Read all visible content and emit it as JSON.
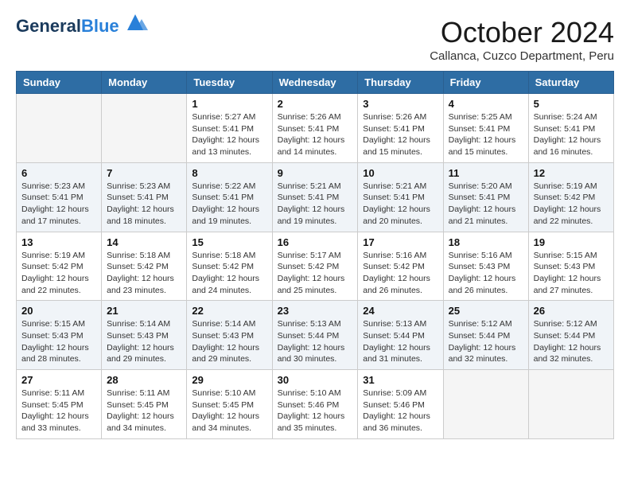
{
  "header": {
    "logo_line1": "General",
    "logo_line2": "Blue",
    "month": "October 2024",
    "location": "Callanca, Cuzco Department, Peru"
  },
  "days_of_week": [
    "Sunday",
    "Monday",
    "Tuesday",
    "Wednesday",
    "Thursday",
    "Friday",
    "Saturday"
  ],
  "weeks": [
    [
      {
        "day": "",
        "sunrise": "",
        "sunset": "",
        "daylight": ""
      },
      {
        "day": "",
        "sunrise": "",
        "sunset": "",
        "daylight": ""
      },
      {
        "day": "1",
        "sunrise": "Sunrise: 5:27 AM",
        "sunset": "Sunset: 5:41 PM",
        "daylight": "Daylight: 12 hours and 13 minutes."
      },
      {
        "day": "2",
        "sunrise": "Sunrise: 5:26 AM",
        "sunset": "Sunset: 5:41 PM",
        "daylight": "Daylight: 12 hours and 14 minutes."
      },
      {
        "day": "3",
        "sunrise": "Sunrise: 5:26 AM",
        "sunset": "Sunset: 5:41 PM",
        "daylight": "Daylight: 12 hours and 15 minutes."
      },
      {
        "day": "4",
        "sunrise": "Sunrise: 5:25 AM",
        "sunset": "Sunset: 5:41 PM",
        "daylight": "Daylight: 12 hours and 15 minutes."
      },
      {
        "day": "5",
        "sunrise": "Sunrise: 5:24 AM",
        "sunset": "Sunset: 5:41 PM",
        "daylight": "Daylight: 12 hours and 16 minutes."
      }
    ],
    [
      {
        "day": "6",
        "sunrise": "Sunrise: 5:23 AM",
        "sunset": "Sunset: 5:41 PM",
        "daylight": "Daylight: 12 hours and 17 minutes."
      },
      {
        "day": "7",
        "sunrise": "Sunrise: 5:23 AM",
        "sunset": "Sunset: 5:41 PM",
        "daylight": "Daylight: 12 hours and 18 minutes."
      },
      {
        "day": "8",
        "sunrise": "Sunrise: 5:22 AM",
        "sunset": "Sunset: 5:41 PM",
        "daylight": "Daylight: 12 hours and 19 minutes."
      },
      {
        "day": "9",
        "sunrise": "Sunrise: 5:21 AM",
        "sunset": "Sunset: 5:41 PM",
        "daylight": "Daylight: 12 hours and 19 minutes."
      },
      {
        "day": "10",
        "sunrise": "Sunrise: 5:21 AM",
        "sunset": "Sunset: 5:41 PM",
        "daylight": "Daylight: 12 hours and 20 minutes."
      },
      {
        "day": "11",
        "sunrise": "Sunrise: 5:20 AM",
        "sunset": "Sunset: 5:41 PM",
        "daylight": "Daylight: 12 hours and 21 minutes."
      },
      {
        "day": "12",
        "sunrise": "Sunrise: 5:19 AM",
        "sunset": "Sunset: 5:42 PM",
        "daylight": "Daylight: 12 hours and 22 minutes."
      }
    ],
    [
      {
        "day": "13",
        "sunrise": "Sunrise: 5:19 AM",
        "sunset": "Sunset: 5:42 PM",
        "daylight": "Daylight: 12 hours and 22 minutes."
      },
      {
        "day": "14",
        "sunrise": "Sunrise: 5:18 AM",
        "sunset": "Sunset: 5:42 PM",
        "daylight": "Daylight: 12 hours and 23 minutes."
      },
      {
        "day": "15",
        "sunrise": "Sunrise: 5:18 AM",
        "sunset": "Sunset: 5:42 PM",
        "daylight": "Daylight: 12 hours and 24 minutes."
      },
      {
        "day": "16",
        "sunrise": "Sunrise: 5:17 AM",
        "sunset": "Sunset: 5:42 PM",
        "daylight": "Daylight: 12 hours and 25 minutes."
      },
      {
        "day": "17",
        "sunrise": "Sunrise: 5:16 AM",
        "sunset": "Sunset: 5:42 PM",
        "daylight": "Daylight: 12 hours and 26 minutes."
      },
      {
        "day": "18",
        "sunrise": "Sunrise: 5:16 AM",
        "sunset": "Sunset: 5:43 PM",
        "daylight": "Daylight: 12 hours and 26 minutes."
      },
      {
        "day": "19",
        "sunrise": "Sunrise: 5:15 AM",
        "sunset": "Sunset: 5:43 PM",
        "daylight": "Daylight: 12 hours and 27 minutes."
      }
    ],
    [
      {
        "day": "20",
        "sunrise": "Sunrise: 5:15 AM",
        "sunset": "Sunset: 5:43 PM",
        "daylight": "Daylight: 12 hours and 28 minutes."
      },
      {
        "day": "21",
        "sunrise": "Sunrise: 5:14 AM",
        "sunset": "Sunset: 5:43 PM",
        "daylight": "Daylight: 12 hours and 29 minutes."
      },
      {
        "day": "22",
        "sunrise": "Sunrise: 5:14 AM",
        "sunset": "Sunset: 5:43 PM",
        "daylight": "Daylight: 12 hours and 29 minutes."
      },
      {
        "day": "23",
        "sunrise": "Sunrise: 5:13 AM",
        "sunset": "Sunset: 5:44 PM",
        "daylight": "Daylight: 12 hours and 30 minutes."
      },
      {
        "day": "24",
        "sunrise": "Sunrise: 5:13 AM",
        "sunset": "Sunset: 5:44 PM",
        "daylight": "Daylight: 12 hours and 31 minutes."
      },
      {
        "day": "25",
        "sunrise": "Sunrise: 5:12 AM",
        "sunset": "Sunset: 5:44 PM",
        "daylight": "Daylight: 12 hours and 32 minutes."
      },
      {
        "day": "26",
        "sunrise": "Sunrise: 5:12 AM",
        "sunset": "Sunset: 5:44 PM",
        "daylight": "Daylight: 12 hours and 32 minutes."
      }
    ],
    [
      {
        "day": "27",
        "sunrise": "Sunrise: 5:11 AM",
        "sunset": "Sunset: 5:45 PM",
        "daylight": "Daylight: 12 hours and 33 minutes."
      },
      {
        "day": "28",
        "sunrise": "Sunrise: 5:11 AM",
        "sunset": "Sunset: 5:45 PM",
        "daylight": "Daylight: 12 hours and 34 minutes."
      },
      {
        "day": "29",
        "sunrise": "Sunrise: 5:10 AM",
        "sunset": "Sunset: 5:45 PM",
        "daylight": "Daylight: 12 hours and 34 minutes."
      },
      {
        "day": "30",
        "sunrise": "Sunrise: 5:10 AM",
        "sunset": "Sunset: 5:46 PM",
        "daylight": "Daylight: 12 hours and 35 minutes."
      },
      {
        "day": "31",
        "sunrise": "Sunrise: 5:09 AM",
        "sunset": "Sunset: 5:46 PM",
        "daylight": "Daylight: 12 hours and 36 minutes."
      },
      {
        "day": "",
        "sunrise": "",
        "sunset": "",
        "daylight": ""
      },
      {
        "day": "",
        "sunrise": "",
        "sunset": "",
        "daylight": ""
      }
    ]
  ]
}
